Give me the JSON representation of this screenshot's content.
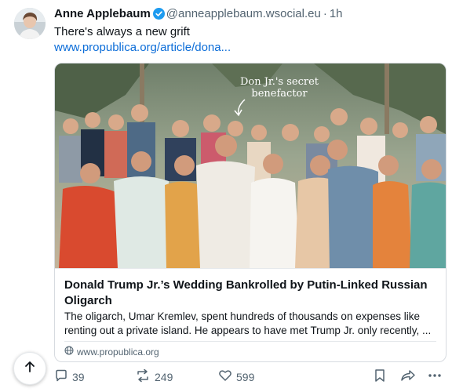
{
  "post": {
    "author": "Anne Applebaum",
    "handle": "@anneapplebaum.wsocial.eu",
    "separator": "·",
    "time": "1h",
    "text": "There's always a new grift",
    "link_text": "www.propublica.org/article/dona..."
  },
  "card": {
    "overlay_line1": "Don Jr.'s secret",
    "overlay_line2": "benefactor",
    "title": "Donald Trump Jr.’s Wedding Bankrolled by Putin-Linked Russian Oligarch",
    "description": "The oligarch, Umar Kremlev, spent hundreds of thousands on expenses like renting out a private island. He appears to have met Trump Jr. only recently, ...",
    "domain": "www.propublica.org"
  },
  "actions": {
    "replies": "39",
    "reposts": "249",
    "likes": "599"
  },
  "colors": {
    "link": "#0c6dd8",
    "verified": "#1d9bf0",
    "muted": "#536471"
  }
}
